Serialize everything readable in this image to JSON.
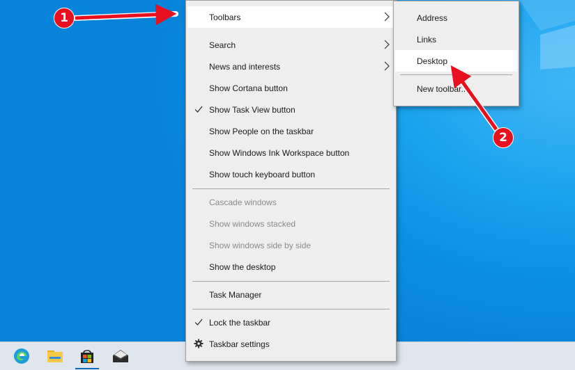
{
  "menu": {
    "items": [
      {
        "label": "Toolbars",
        "submenu": true
      },
      {
        "label": "Search",
        "submenu": true
      },
      {
        "label": "News and interests",
        "submenu": true
      },
      {
        "label": "Show Cortana button"
      },
      {
        "label": "Show Task View button",
        "checked": true
      },
      {
        "label": "Show People on the taskbar"
      },
      {
        "label": "Show Windows Ink Workspace button"
      },
      {
        "label": "Show touch keyboard button"
      },
      {
        "label": "Cascade windows",
        "disabled": true
      },
      {
        "label": "Show windows stacked",
        "disabled": true
      },
      {
        "label": "Show windows side by side",
        "disabled": true
      },
      {
        "label": "Show the desktop"
      },
      {
        "label": "Task Manager"
      },
      {
        "label": "Lock the taskbar",
        "checked": true
      },
      {
        "label": "Taskbar settings",
        "icon": "gear-icon"
      }
    ]
  },
  "submenu": {
    "items": [
      {
        "label": "Address"
      },
      {
        "label": "Links"
      },
      {
        "label": "Desktop"
      },
      {
        "label": "New toolbar..."
      }
    ]
  },
  "annotations": {
    "badge1": "1",
    "badge2": "2",
    "color": "#e8101e"
  },
  "taskbar": {
    "icons": [
      "edge-icon",
      "file-explorer-icon",
      "microsoft-store-icon",
      "mail-icon"
    ]
  }
}
